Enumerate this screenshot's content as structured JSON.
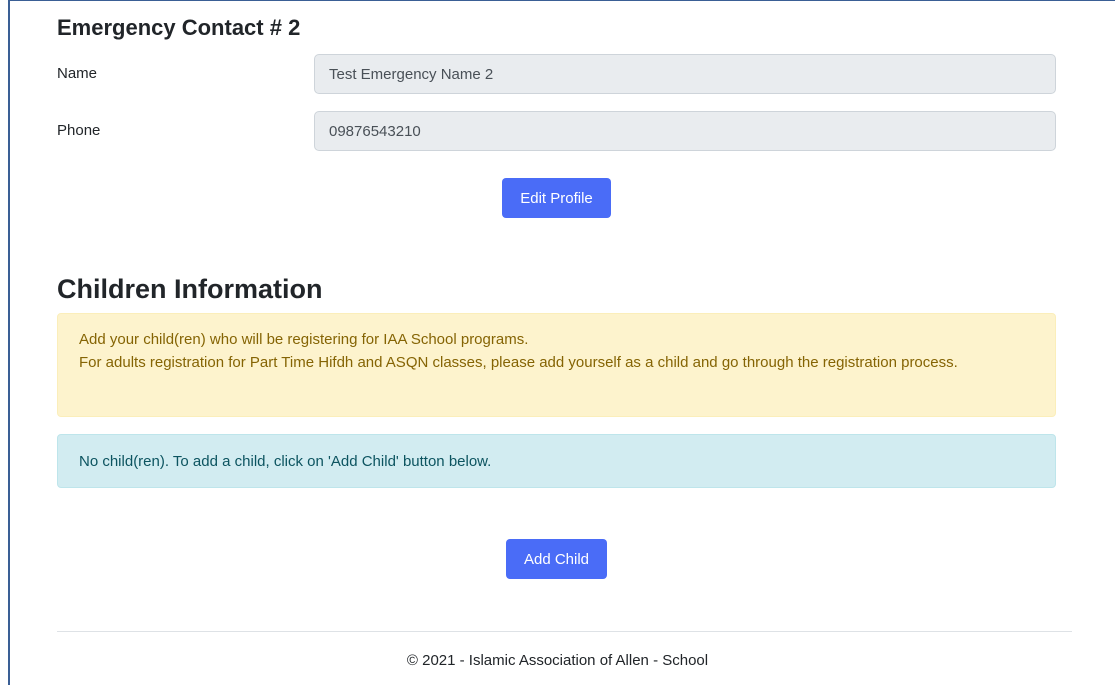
{
  "emergency_contact": {
    "heading": "Emergency Contact # 2",
    "name_label": "Name",
    "name_value": "Test Emergency Name 2",
    "phone_label": "Phone",
    "phone_value": "09876543210",
    "edit_button_label": "Edit Profile"
  },
  "children": {
    "heading": "Children Information",
    "notice_line1": "Add your child(ren) who will be registering for IAA School programs.",
    "notice_line2": "For adults registration for Part Time Hifdh and ASQN classes, please add yourself as a child and go through the registration process.",
    "empty_message": "No child(ren). To add a child, click on 'Add Child' button below.",
    "add_button_label": "Add Child"
  },
  "footer": {
    "copyright": "© 2021 - Islamic Association of Allen - School"
  },
  "colors": {
    "primary_button": "#4a6cf7",
    "warning_bg": "#fdf3cd",
    "warning_text": "#856404",
    "info_bg": "#d2ecf1",
    "info_text": "#0c5460",
    "readonly_input_bg": "#e9ecef"
  }
}
